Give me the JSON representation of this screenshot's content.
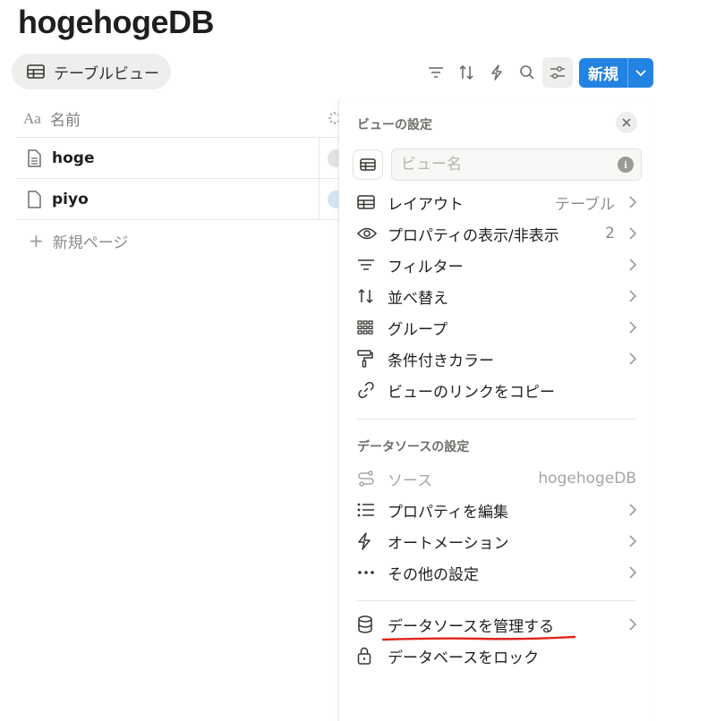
{
  "database": {
    "title": "hogehogeDB"
  },
  "view_tab": {
    "label": "テーブルビュー",
    "icon": "table-icon"
  },
  "toolbar": {
    "icons": [
      "filter-icon",
      "sort-icon",
      "automation-icon",
      "search-icon",
      "settings-icon"
    ],
    "new_button": "新規"
  },
  "table": {
    "name_header": "名前",
    "name_header_icon": "Aa",
    "rows": [
      {
        "title": "hoge"
      },
      {
        "title": "piyo"
      }
    ],
    "new_page_label": "新規ページ",
    "new_page_plus": "+"
  },
  "panel": {
    "title": "ビューの設定",
    "name_placeholder": "ビュー名",
    "info_glyph": "i",
    "view_items": [
      {
        "label": "レイアウト",
        "value": "テーブル",
        "icon": "table-icon"
      },
      {
        "label": "プロパティの表示/非表示",
        "value": "2",
        "icon": "eye-icon"
      },
      {
        "label": "フィルター",
        "value": "",
        "icon": "filter-icon"
      },
      {
        "label": "並べ替え",
        "value": "",
        "icon": "sort-icon"
      },
      {
        "label": "グループ",
        "value": "",
        "icon": "group-icon"
      },
      {
        "label": "条件付きカラー",
        "value": "",
        "icon": "paint-roller-icon"
      },
      {
        "label": "ビューのリンクをコピー",
        "value": "",
        "icon": "link-icon"
      }
    ],
    "datasource_title": "データソースの設定",
    "datasource_items": [
      {
        "label": "ソース",
        "value": "hogehogeDB",
        "icon": "source-icon"
      },
      {
        "label": "プロパティを編集",
        "value": "",
        "icon": "list-icon"
      },
      {
        "label": "オートメーション",
        "value": "",
        "icon": "automation-icon"
      },
      {
        "label": "その他の設定",
        "value": "",
        "icon": "more-icon"
      }
    ],
    "bottom_items": [
      {
        "label": "データソースを管理する",
        "icon": "database-icon"
      },
      {
        "label": "データベースをロック",
        "icon": "lock-icon"
      }
    ]
  },
  "colors": {
    "accent": "#2383e2",
    "annotation": "#e0251b"
  }
}
